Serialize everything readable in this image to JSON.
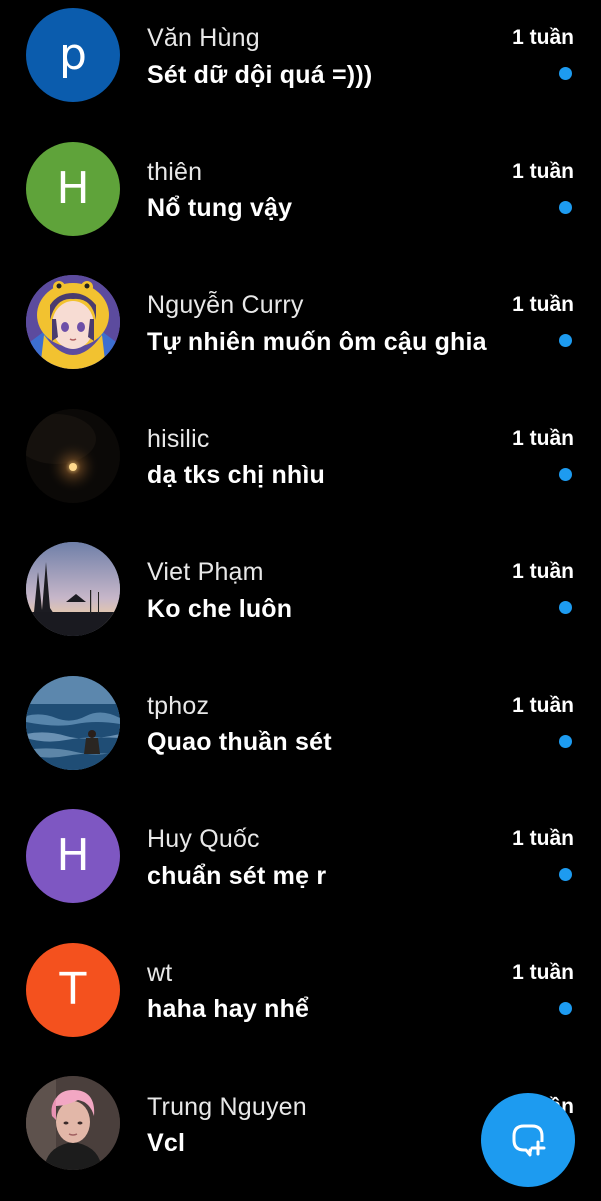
{
  "colors": {
    "background": "#000000",
    "accent": "#1d9bf0",
    "unread_dot": "#1d9bf0"
  },
  "conversations": [
    {
      "name": "Văn Hùng",
      "message": "Sét dữ dội quá =)))",
      "time": "1 tuần",
      "unread": true,
      "avatar": {
        "type": "letter",
        "letter": "p",
        "color": "#0b5cad"
      }
    },
    {
      "name": "thiên",
      "message": "Nổ tung vậy",
      "time": "1 tuần",
      "unread": true,
      "avatar": {
        "type": "letter",
        "letter": "H",
        "color": "#5fa33a"
      }
    },
    {
      "name": "Nguyễn Curry",
      "message": "Tự nhiên muốn ôm cậu ghia",
      "time": "1 tuần",
      "unread": true,
      "avatar": {
        "type": "image",
        "icon": "anime-character-avatar"
      }
    },
    {
      "name": "hisilic",
      "message": "dạ tks chị nhìu",
      "time": "1 tuần",
      "unread": true,
      "avatar": {
        "type": "image",
        "icon": "night-moon-avatar"
      }
    },
    {
      "name": "Viet Phạm",
      "message": "Ko che luôn",
      "time": "1 tuần",
      "unread": true,
      "avatar": {
        "type": "image",
        "icon": "sunset-landscape-avatar"
      }
    },
    {
      "name": "tphoz",
      "message": "Quao thuần sét",
      "time": "1 tuần",
      "unread": true,
      "avatar": {
        "type": "image",
        "icon": "ocean-person-avatar"
      }
    },
    {
      "name": "Huy Quốc",
      "message": "chuẩn sét mẹ r",
      "time": "1 tuần",
      "unread": true,
      "avatar": {
        "type": "letter",
        "letter": "H",
        "color": "#7e57c2"
      }
    },
    {
      "name": "wt",
      "message": "haha hay nhể",
      "time": "1 tuần",
      "unread": true,
      "avatar": {
        "type": "letter",
        "letter": "T",
        "color": "#f4511e"
      }
    },
    {
      "name": "Trung Nguyen",
      "message": "Vcl",
      "time": "1 tuần",
      "unread": false,
      "avatar": {
        "type": "image",
        "icon": "pink-hair-person-avatar"
      }
    }
  ],
  "fab": {
    "icon": "new-message-icon"
  }
}
